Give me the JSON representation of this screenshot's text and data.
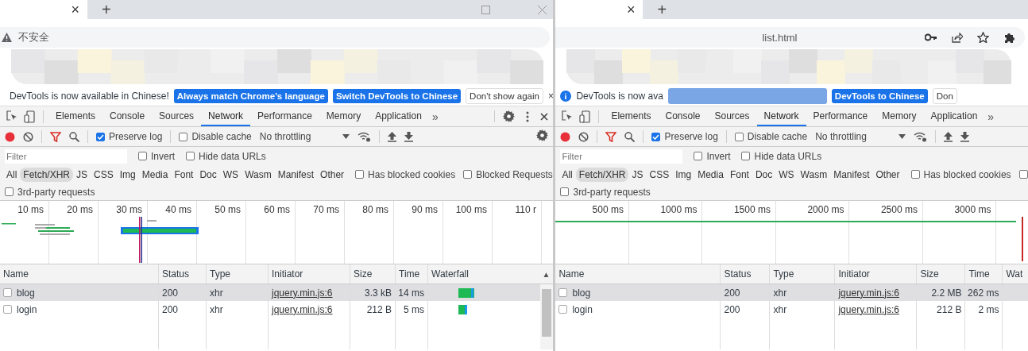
{
  "panes": [
    {
      "tab_close": "×",
      "new_tab": "+",
      "window_controls": true,
      "address": {
        "text": "不安全",
        "insecure": true,
        "actions_visible": false
      },
      "infobar": {
        "message": "DevTools is now available in Chinese!",
        "redacted": false,
        "buttons": [
          {
            "label": "Always match Chrome's language",
            "kind": "primary"
          },
          {
            "label": "Switch DevTools to Chinese",
            "kind": "primary"
          },
          {
            "label": "Don't show again",
            "kind": "plain"
          }
        ],
        "close": "×"
      },
      "panel_tabs": [
        {
          "label": "Elements",
          "selected": false
        },
        {
          "label": "Console",
          "selected": false
        },
        {
          "label": "Sources",
          "selected": false
        },
        {
          "label": "Network",
          "selected": true
        },
        {
          "label": "Performance",
          "selected": false
        },
        {
          "label": "Memory",
          "selected": false
        },
        {
          "label": "Application",
          "selected": false
        }
      ],
      "more": "»",
      "panel_actions": true,
      "toolbar": {
        "checks": [
          {
            "label": "Preserve log",
            "checked": true
          },
          {
            "label": "Disable cache",
            "checked": false
          }
        ],
        "throttling": "No throttling",
        "settings": true
      },
      "filter": {
        "placeholder": "Filter",
        "checks": [
          {
            "label": "Invert",
            "checked": false
          },
          {
            "label": "Hide data URLs",
            "checked": false
          }
        ]
      },
      "types": [
        {
          "label": "All",
          "selected": false
        },
        {
          "label": "Fetch/XHR",
          "selected": true
        },
        {
          "label": "JS",
          "selected": false
        },
        {
          "label": "CSS",
          "selected": false
        },
        {
          "label": "Img",
          "selected": false
        },
        {
          "label": "Media",
          "selected": false
        },
        {
          "label": "Font",
          "selected": false
        },
        {
          "label": "Doc",
          "selected": false
        },
        {
          "label": "WS",
          "selected": false
        },
        {
          "label": "Wasm",
          "selected": false
        },
        {
          "label": "Manifest",
          "selected": false
        },
        {
          "label": "Other",
          "selected": false
        }
      ],
      "type_checks": [
        {
          "label": "Has blocked cookies",
          "checked": false
        },
        {
          "label": "Blocked Requests",
          "checked": false
        }
      ],
      "third_party": {
        "label": "3rd-party requests",
        "checked": false
      },
      "overview": {
        "kind": "bars",
        "ticks": [
          "10 ms",
          "20 ms",
          "30 ms",
          "40 ms",
          "50 ms",
          "60 ms",
          "70 ms",
          "80 ms",
          "90 ms",
          "100 ms",
          "110 r"
        ]
      },
      "table": {
        "columns": [
          "Name",
          "Status",
          "Type",
          "Initiator",
          "Size",
          "Time",
          "Waterfall"
        ],
        "sort_mark": "▲",
        "waterfall_bars": true,
        "rows": [
          {
            "selected": true,
            "cells": [
              "blog",
              "200",
              "xhr",
              "jquery.min.js:6",
              "3.3 kB",
              "14 ms"
            ]
          },
          {
            "selected": false,
            "cells": [
              "login",
              "200",
              "xhr",
              "jquery.min.js:6",
              "212 B",
              "5 ms"
            ]
          }
        ]
      }
    },
    {
      "tab_close": "×",
      "new_tab": "+",
      "window_controls": false,
      "address": {
        "text": "list.html",
        "insecure": false,
        "actions_visible": true
      },
      "infobar": {
        "message": "DevTools is now ava",
        "redacted": true,
        "buttons": [
          {
            "label": "DevTools to Chinese",
            "kind": "primary"
          },
          {
            "label": "Don",
            "kind": "plain"
          }
        ]
      },
      "panel_tabs": [
        {
          "label": "Elements",
          "selected": false
        },
        {
          "label": "Console",
          "selected": false
        },
        {
          "label": "Sources",
          "selected": false
        },
        {
          "label": "Network",
          "selected": true
        },
        {
          "label": "Performance",
          "selected": false
        },
        {
          "label": "Memory",
          "selected": false
        },
        {
          "label": "Application",
          "selected": false
        }
      ],
      "more": "»",
      "panel_actions": false,
      "toolbar": {
        "checks": [
          {
            "label": "Preserve log",
            "checked": true
          },
          {
            "label": "Disable cache",
            "checked": false
          }
        ],
        "throttling": "No throttling",
        "settings": false
      },
      "filter": {
        "placeholder": "Filter",
        "checks": [
          {
            "label": "Invert",
            "checked": false
          },
          {
            "label": "Hide data URLs",
            "checked": false
          }
        ]
      },
      "types": [
        {
          "label": "All",
          "selected": false
        },
        {
          "label": "Fetch/XHR",
          "selected": true
        },
        {
          "label": "JS",
          "selected": false
        },
        {
          "label": "CSS",
          "selected": false
        },
        {
          "label": "Img",
          "selected": false
        },
        {
          "label": "Media",
          "selected": false
        },
        {
          "label": "Font",
          "selected": false
        },
        {
          "label": "Doc",
          "selected": false
        },
        {
          "label": "WS",
          "selected": false
        },
        {
          "label": "Wasm",
          "selected": false
        },
        {
          "label": "Manifest",
          "selected": false
        },
        {
          "label": "Other",
          "selected": false
        }
      ],
      "type_checks": [
        {
          "label": "Has blocked cookies",
          "checked": false
        },
        {
          "checked": false
        }
      ],
      "third_party": {
        "label": "3rd-party requests",
        "checked": false
      },
      "overview": {
        "kind": "line",
        "ticks": [
          "500 ms",
          "1000 ms",
          "1500 ms",
          "2000 ms",
          "2500 ms",
          "3000 ms"
        ]
      },
      "table": {
        "columns": [
          "Name",
          "Status",
          "Type",
          "Initiator",
          "Size",
          "Time",
          "Wat"
        ],
        "waterfall_bars": false,
        "rows": [
          {
            "selected": true,
            "cells": [
              "blog",
              "200",
              "xhr",
              "jquery.min.js:6",
              "2.2 MB",
              "262 ms"
            ]
          },
          {
            "selected": false,
            "cells": [
              "login",
              "200",
              "xhr",
              "jquery.min.js:6",
              "212 B",
              "2 ms"
            ]
          }
        ]
      }
    }
  ]
}
